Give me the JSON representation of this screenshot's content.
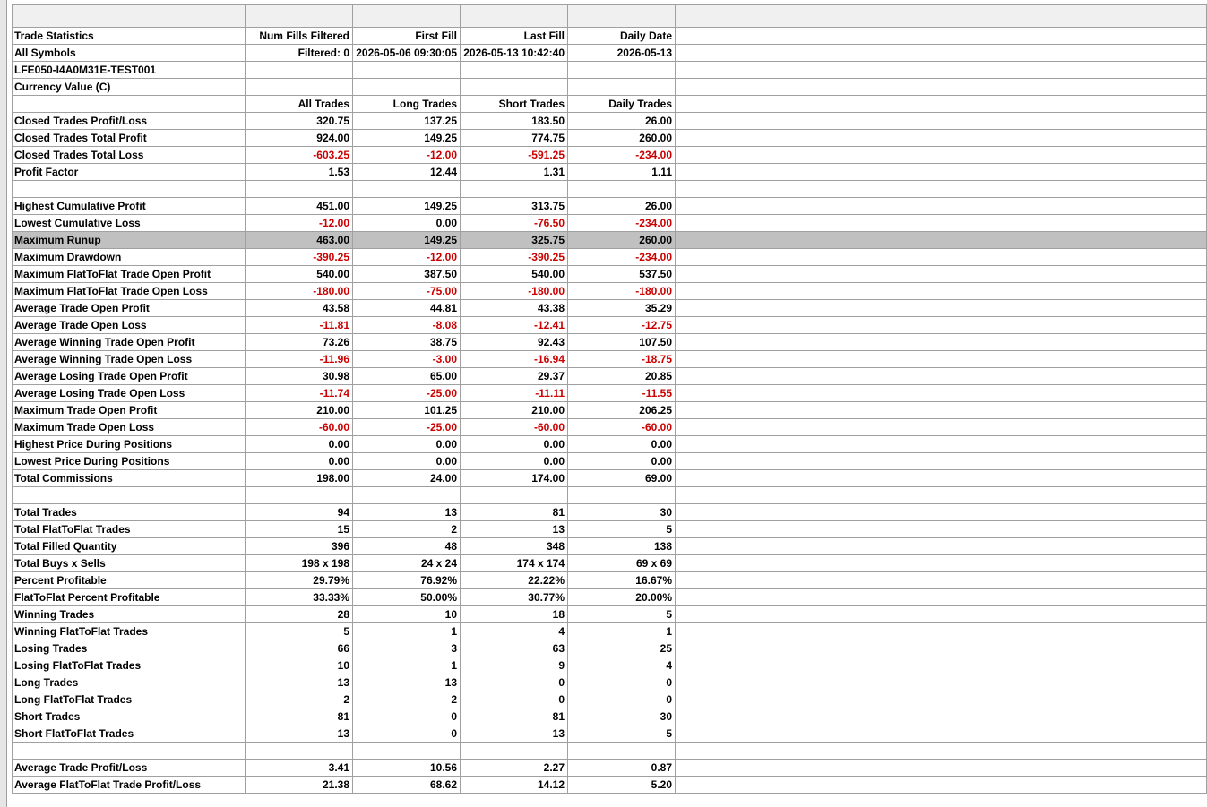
{
  "header": {
    "col1": "Num Fills Filtered",
    "col2": "First Fill",
    "col3": "Last Fill",
    "col4": "Daily Date",
    "title": "Trade Statistics",
    "symbols_label": "All Symbols",
    "filtered_value": "Filtered: 0",
    "first_fill_value": "2026-05-06  09:30:05",
    "last_fill_value": "2026-05-13  10:42:40",
    "daily_date_value": "2026-05-13",
    "account": "LFE050-I4A0M31E-TEST001",
    "currency": "Currency Value (C)"
  },
  "columns": [
    "All Trades",
    "Long Trades",
    "Short Trades",
    "Daily Trades"
  ],
  "rows": [
    {
      "label": "Closed Trades Profit/Loss",
      "values": [
        "320.75",
        "137.25",
        "183.50",
        "26.00"
      ]
    },
    {
      "label": "Closed Trades Total Profit",
      "values": [
        "924.00",
        "149.25",
        "774.75",
        "260.00"
      ]
    },
    {
      "label": "Closed Trades Total Loss",
      "values": [
        "-603.25",
        "-12.00",
        "-591.25",
        "-234.00"
      ]
    },
    {
      "label": "Profit Factor",
      "values": [
        "1.53",
        "12.44",
        "1.31",
        "1.11"
      ]
    },
    {
      "blank": true
    },
    {
      "label": "Highest Cumulative Profit",
      "values": [
        "451.00",
        "149.25",
        "313.75",
        "26.00"
      ]
    },
    {
      "label": "Lowest Cumulative Loss",
      "values": [
        "-12.00",
        "0.00",
        "-76.50",
        "-234.00"
      ]
    },
    {
      "label": "Maximum Runup",
      "values": [
        "463.00",
        "149.25",
        "325.75",
        "260.00"
      ],
      "highlight": true
    },
    {
      "label": "Maximum Drawdown",
      "values": [
        "-390.25",
        "-12.00",
        "-390.25",
        "-234.00"
      ]
    },
    {
      "label": "Maximum FlatToFlat Trade Open Profit",
      "values": [
        "540.00",
        "387.50",
        "540.00",
        "537.50"
      ]
    },
    {
      "label": "Maximum FlatToFlat Trade Open Loss",
      "values": [
        "-180.00",
        "-75.00",
        "-180.00",
        "-180.00"
      ]
    },
    {
      "label": "Average Trade Open Profit",
      "values": [
        "43.58",
        "44.81",
        "43.38",
        "35.29"
      ]
    },
    {
      "label": "Average Trade Open Loss",
      "values": [
        "-11.81",
        "-8.08",
        "-12.41",
        "-12.75"
      ]
    },
    {
      "label": "Average Winning Trade Open Profit",
      "values": [
        "73.26",
        "38.75",
        "92.43",
        "107.50"
      ]
    },
    {
      "label": "Average Winning Trade Open Loss",
      "values": [
        "-11.96",
        "-3.00",
        "-16.94",
        "-18.75"
      ]
    },
    {
      "label": "Average Losing Trade Open Profit",
      "values": [
        "30.98",
        "65.00",
        "29.37",
        "20.85"
      ]
    },
    {
      "label": "Average Losing Trade Open Loss",
      "values": [
        "-11.74",
        "-25.00",
        "-11.11",
        "-11.55"
      ]
    },
    {
      "label": "Maximum Trade Open Profit",
      "values": [
        "210.00",
        "101.25",
        "210.00",
        "206.25"
      ]
    },
    {
      "label": "Maximum Trade Open Loss",
      "values": [
        "-60.00",
        "-25.00",
        "-60.00",
        "-60.00"
      ]
    },
    {
      "label": "Highest Price During Positions",
      "values": [
        "0.00",
        "0.00",
        "0.00",
        "0.00"
      ]
    },
    {
      "label": "Lowest Price During Positions",
      "values": [
        "0.00",
        "0.00",
        "0.00",
        "0.00"
      ]
    },
    {
      "label": "Total Commissions",
      "values": [
        "198.00",
        "24.00",
        "174.00",
        "69.00"
      ]
    },
    {
      "blank": true
    },
    {
      "label": "Total Trades",
      "values": [
        "94",
        "13",
        "81",
        "30"
      ]
    },
    {
      "label": "Total FlatToFlat Trades",
      "values": [
        "15",
        "2",
        "13",
        "5"
      ]
    },
    {
      "label": "Total Filled Quantity",
      "values": [
        "396",
        "48",
        "348",
        "138"
      ]
    },
    {
      "label": "Total Buys x Sells",
      "values": [
        "198 x 198",
        "24 x 24",
        "174 x 174",
        "69 x 69"
      ]
    },
    {
      "label": "Percent Profitable",
      "values": [
        "29.79%",
        "76.92%",
        "22.22%",
        "16.67%"
      ]
    },
    {
      "label": "FlatToFlat Percent Profitable",
      "values": [
        "33.33%",
        "50.00%",
        "30.77%",
        "20.00%"
      ]
    },
    {
      "label": "Winning Trades",
      "values": [
        "28",
        "10",
        "18",
        "5"
      ]
    },
    {
      "label": "Winning FlatToFlat Trades",
      "values": [
        "5",
        "1",
        "4",
        "1"
      ]
    },
    {
      "label": "Losing Trades",
      "values": [
        "66",
        "3",
        "63",
        "25"
      ]
    },
    {
      "label": "Losing FlatToFlat Trades",
      "values": [
        "10",
        "1",
        "9",
        "4"
      ]
    },
    {
      "label": "Long Trades",
      "values": [
        "13",
        "13",
        "0",
        "0"
      ]
    },
    {
      "label": "Long FlatToFlat Trades",
      "values": [
        "2",
        "2",
        "0",
        "0"
      ]
    },
    {
      "label": "Short Trades",
      "values": [
        "81",
        "0",
        "81",
        "30"
      ]
    },
    {
      "label": "Short FlatToFlat Trades",
      "values": [
        "13",
        "0",
        "13",
        "5"
      ]
    },
    {
      "blank": true
    },
    {
      "label": "Average Trade Profit/Loss",
      "values": [
        "3.41",
        "10.56",
        "2.27",
        "0.87"
      ]
    },
    {
      "label": "Average FlatToFlat Trade Profit/Loss",
      "values": [
        "21.38",
        "68.62",
        "14.12",
        "5.20"
      ]
    }
  ],
  "colors": {
    "negative": "#cc0000",
    "highlight_row": "#c0c0c0",
    "grid_line": "#a0a0a0"
  }
}
